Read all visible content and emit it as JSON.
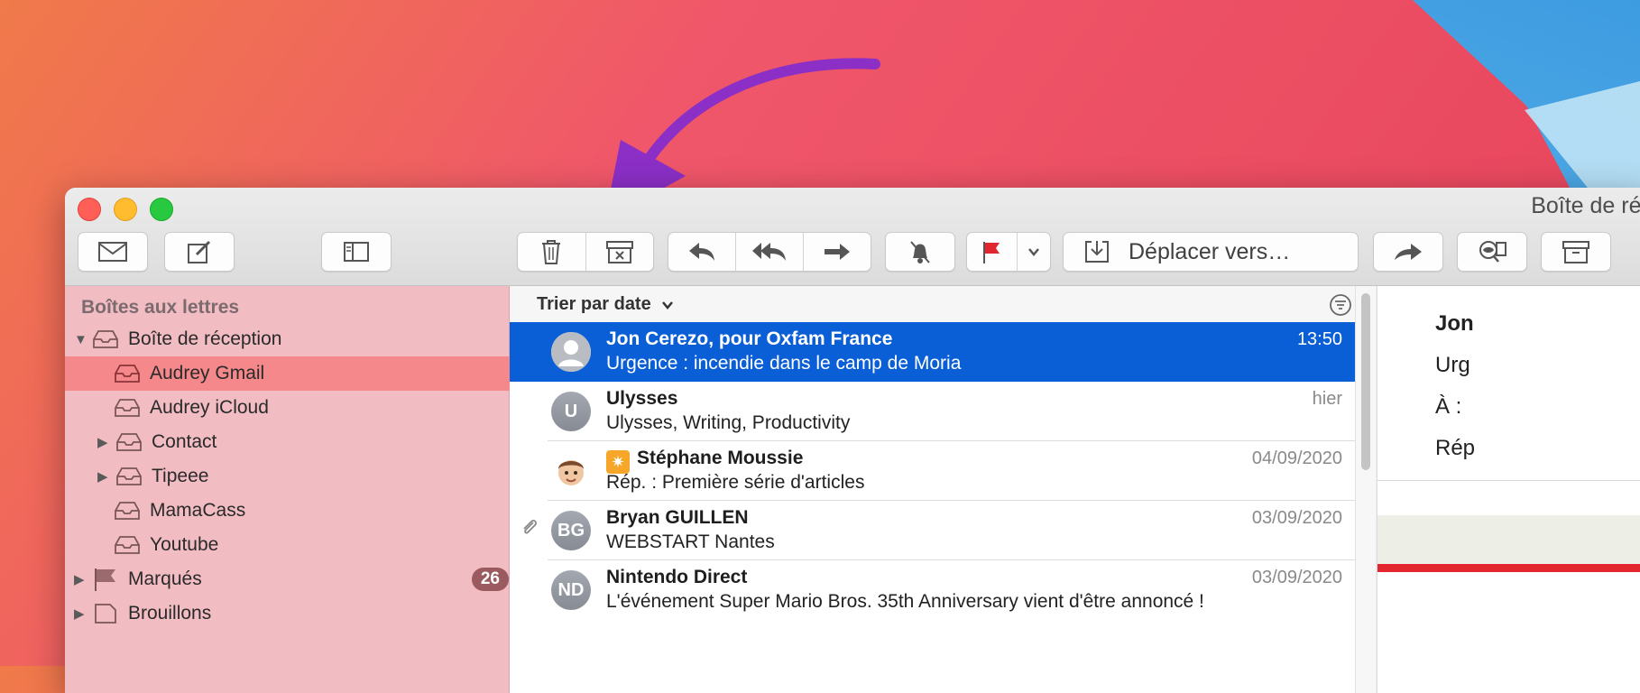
{
  "window": {
    "title": "Boîte de réc"
  },
  "toolbar": {
    "move_to_label": "Déplacer vers…",
    "buttons": [
      "envelope-icon",
      "compose-icon",
      "sidebar-icon",
      "trash-icon",
      "junk-icon",
      "reply-icon",
      "reply-all-icon",
      "forward-icon",
      "mute-icon",
      "flag-icon",
      "move-icon",
      "redirect-icon",
      "search-mail-icon",
      "archive-icon"
    ]
  },
  "sidebar": {
    "heading": "Boîtes aux lettres",
    "items": [
      {
        "label": "Boîte de réception"
      },
      {
        "label": "Audrey Gmail"
      },
      {
        "label": "Audrey iCloud"
      },
      {
        "label": "Contact"
      },
      {
        "label": "Tipeee"
      },
      {
        "label": "MamaCass"
      },
      {
        "label": "Youtube"
      },
      {
        "label": "Marqués",
        "badge": "26"
      },
      {
        "label": "Brouillons"
      }
    ]
  },
  "list": {
    "sort_label": "Trier par date",
    "messages": [
      {
        "sender": "Jon Cerezo, pour Oxfam France",
        "subject": "Urgence : incendie dans le camp de Moria",
        "date": "13:50",
        "initials": ""
      },
      {
        "sender": "Ulysses",
        "subject": "Ulysses, Writing, Productivity",
        "date": "hier",
        "initials": "U"
      },
      {
        "sender": "Stéphane Moussie",
        "subject": "Rép. : Première série d'articles",
        "date": "04/09/2020",
        "initials": ""
      },
      {
        "sender": "Bryan GUILLEN",
        "subject": "WEBSTART Nantes",
        "date": "03/09/2020",
        "initials": "BG"
      },
      {
        "sender": "Nintendo Direct",
        "subject": "L'événement Super Mario Bros. 35th Anniversary vient d'être annoncé !",
        "date": "03/09/2020",
        "initials": "ND"
      }
    ]
  },
  "preview": {
    "lines": [
      "Jon",
      "Urg",
      "À :",
      "Rép"
    ]
  },
  "colors": {
    "selection": "#0a5fd6",
    "sidebar": "#f2bcc3",
    "sidebar_selected": "#f4888b",
    "arrow": "#8b2fc6",
    "flag": "#e0262e"
  }
}
